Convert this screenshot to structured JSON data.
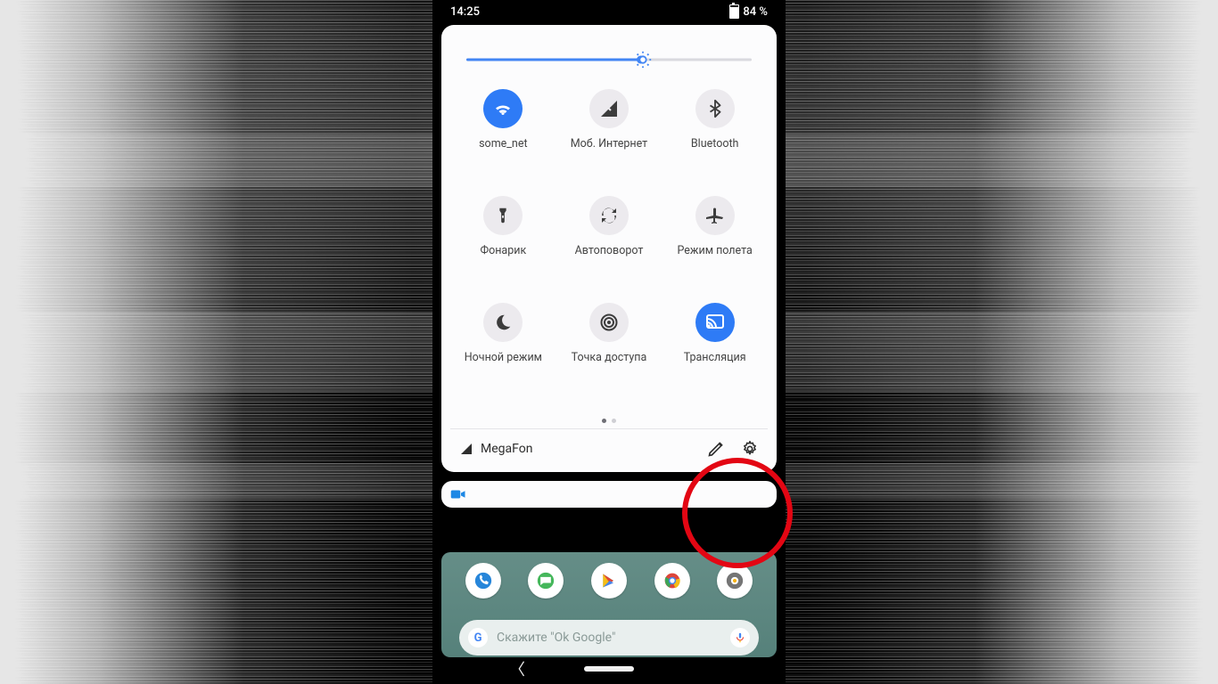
{
  "status": {
    "time": "14:25",
    "battery": "84 %"
  },
  "brightness": {
    "percent": 62
  },
  "tiles": [
    {
      "label": "some_net",
      "icon": "wifi",
      "active": true
    },
    {
      "label": "Моб. Интернет",
      "icon": "mobile-data",
      "active": false
    },
    {
      "label": "Bluetooth",
      "icon": "bluetooth",
      "active": false
    },
    {
      "label": "Фонарик",
      "icon": "flashlight",
      "active": false
    },
    {
      "label": "Автоповорот",
      "icon": "autorotate",
      "active": false
    },
    {
      "label": "Режим полета",
      "icon": "airplane",
      "active": false
    },
    {
      "label": "Ночной режим",
      "icon": "night",
      "active": false
    },
    {
      "label": "Точка доступа",
      "icon": "hotspot",
      "active": false
    },
    {
      "label": "Трансляция",
      "icon": "cast",
      "active": true
    }
  ],
  "pager": {
    "pages": 2,
    "current": 0
  },
  "footer": {
    "carrier": "MegaFon"
  },
  "search": {
    "placeholder": "Скажите \"Ok Google\""
  }
}
